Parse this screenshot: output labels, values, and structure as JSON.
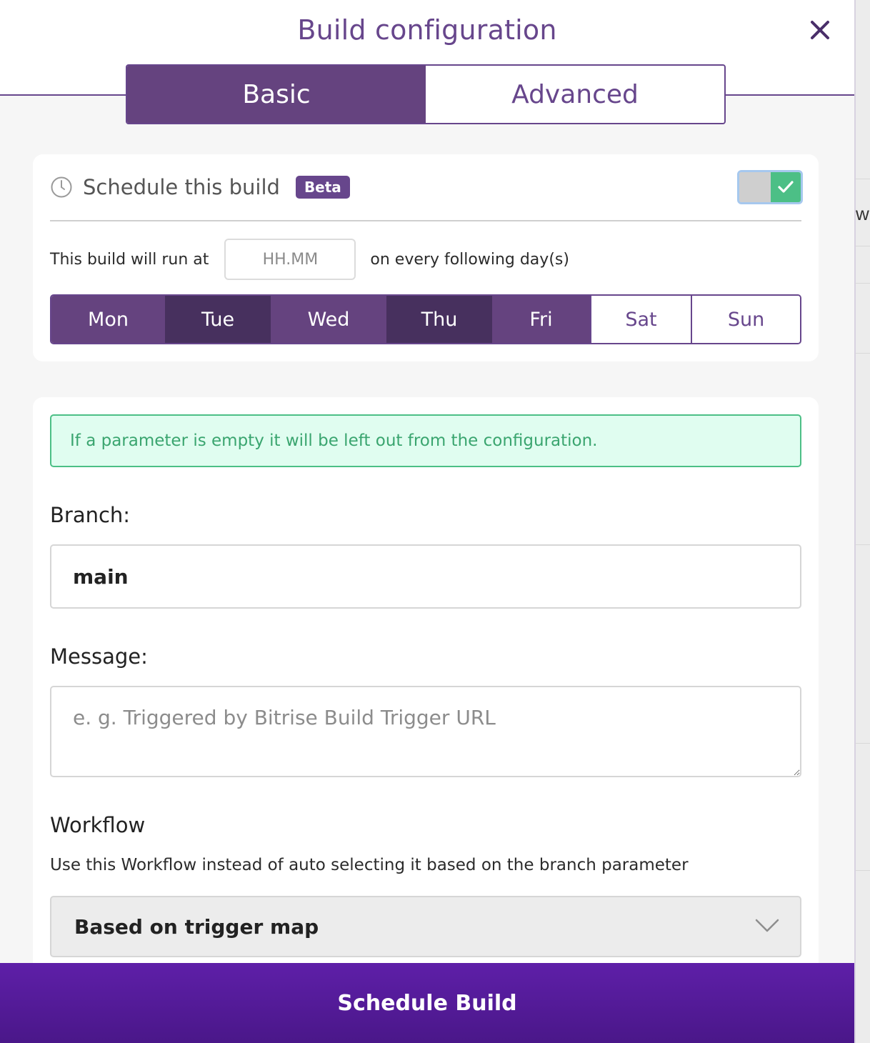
{
  "header": {
    "title": "Build configuration"
  },
  "tabs": [
    {
      "label": "Basic",
      "active": true
    },
    {
      "label": "Advanced",
      "active": false
    }
  ],
  "schedule": {
    "title": "Schedule this build",
    "badge": "Beta",
    "enabled": true,
    "run_prefix": "This build will run at",
    "time_placeholder": "HH.MM",
    "run_suffix": "on every following day(s)",
    "days": [
      {
        "label": "Mon",
        "selected": true
      },
      {
        "label": "Tue",
        "selected": true
      },
      {
        "label": "Wed",
        "selected": true
      },
      {
        "label": "Thu",
        "selected": true
      },
      {
        "label": "Fri",
        "selected": true
      },
      {
        "label": "Sat",
        "selected": false
      },
      {
        "label": "Sun",
        "selected": false
      }
    ]
  },
  "params": {
    "notice": "If a parameter is empty it will be left out from the configuration.",
    "branch_label": "Branch:",
    "branch_value": "main",
    "message_label": "Message:",
    "message_placeholder": "e. g. Triggered by Bitrise Build Trigger URL",
    "workflow_label": "Workflow",
    "workflow_help": "Use this Workflow instead of auto selecting it based on the branch parameter",
    "workflow_selected": "Based on trigger map"
  },
  "footer": {
    "submit_label": "Schedule Build"
  },
  "backdrop": {
    "peek_text": "w"
  },
  "colors": {
    "accent": "#65437f",
    "success": "#4cbf86",
    "cta": "#5e1fa8"
  }
}
